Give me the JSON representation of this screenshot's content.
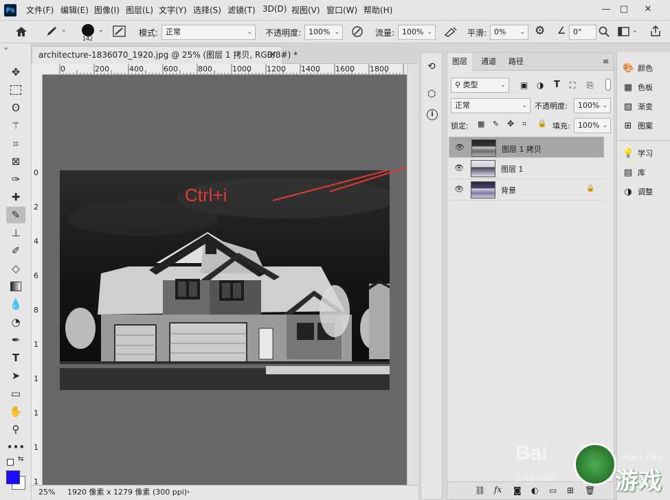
{
  "app": {
    "logo": "Ps"
  },
  "menu": [
    "文件(F)",
    "编辑(E)",
    "图像(I)",
    "图层(L)",
    "文字(Y)",
    "选择(S)",
    "滤镜(T)",
    "3D(D)",
    "视图(V)",
    "窗口(W)",
    "帮助(H)"
  ],
  "window_controls": {
    "minimize": "—",
    "restore": "□",
    "close": "✕"
  },
  "options": {
    "brush_size": "142",
    "mode_label": "模式:",
    "mode_value": "正常",
    "opacity_label": "不透明度:",
    "opacity_value": "100%",
    "flow_label": "流量:",
    "flow_value": "100%",
    "smooth_label": "平滑:",
    "smooth_value": "0%",
    "angle_value": "0°"
  },
  "document": {
    "tab_title": "architecture-1836070_1920.jpg @ 25% (图层 1 拷贝, RGB/8#) *",
    "close_glyph": "×",
    "ruler_h": [
      "0",
      "200",
      "400",
      "600",
      "800",
      "1000",
      "1200",
      "1400",
      "1600",
      "1800"
    ],
    "ruler_v": [
      "0",
      "2",
      "4",
      "6",
      "8",
      "1",
      "1",
      "1",
      "1",
      "1",
      "2"
    ],
    "annotation": "Ctrl+i",
    "annotation_color": "#e53935"
  },
  "status": {
    "zoom": "25%",
    "dims": "1920 像素 x 1279 像素 (300 ppi)"
  },
  "layers_panel": {
    "tabs": [
      "图层",
      "通道",
      "路径"
    ],
    "filter_kind": "类型",
    "blend_mode": "正常",
    "opacity_label": "不透明度:",
    "opacity_value": "100%",
    "lock_label": "锁定:",
    "fill_label": "填充:",
    "fill_value": "100%",
    "layers": [
      {
        "name": "图层 1 拷贝",
        "selected": true
      },
      {
        "name": "图层 1",
        "selected": false
      },
      {
        "name": "背景",
        "selected": false,
        "locked": true
      }
    ]
  },
  "right_panels": {
    "group1": [
      "颜色",
      "色板",
      "渐变",
      "图案"
    ],
    "group2": [
      "学习",
      "库",
      "调整"
    ]
  },
  "watermark": {
    "baidu": "Bai",
    "baidu_sub": "jingyan",
    "site": "游戏",
    "site_url": "xiayx.com"
  }
}
